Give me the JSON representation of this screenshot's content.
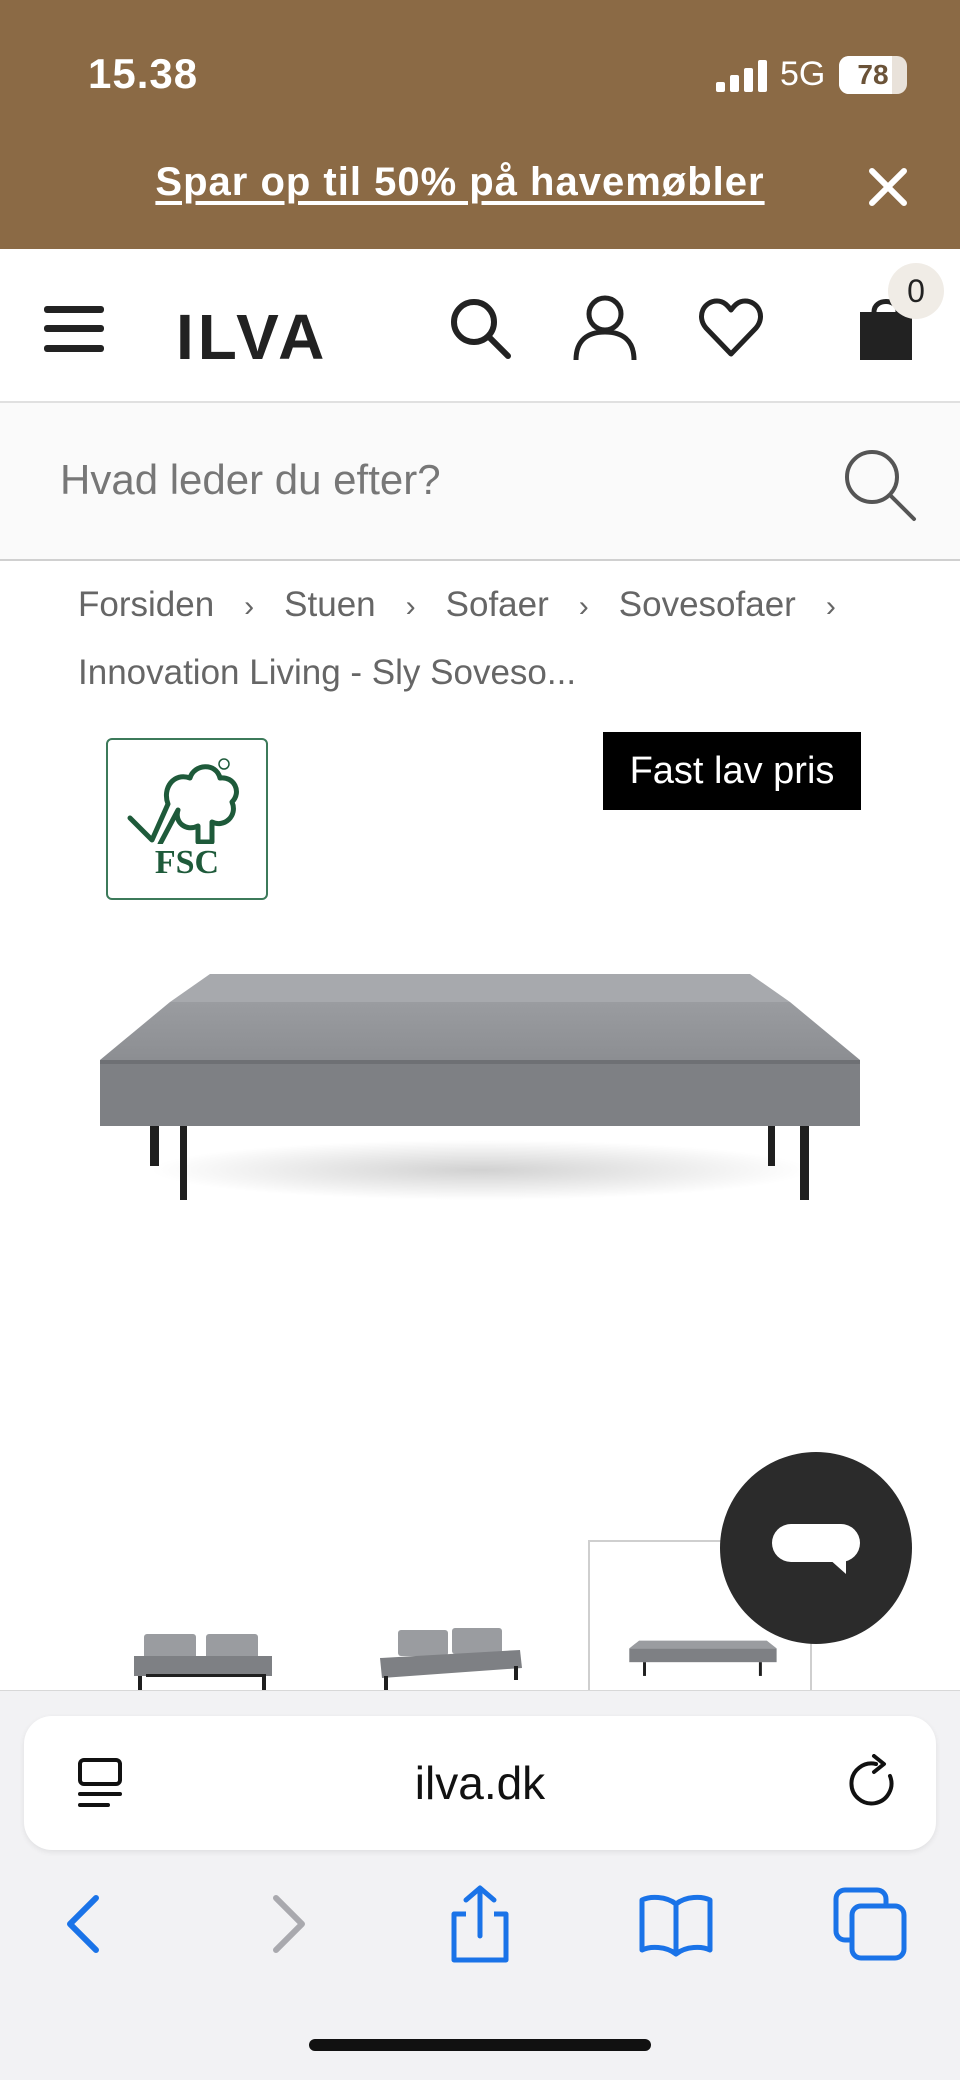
{
  "status_bar": {
    "time": "15.38",
    "network": "5G",
    "battery_percent": "78",
    "battery_level": 0.78,
    "icons": [
      "signal-icon",
      "battery-icon"
    ]
  },
  "promo": {
    "text": "Spar op til 50% på havemøbler",
    "close_icon": "close-icon"
  },
  "header": {
    "logo": "ILVA",
    "icons": [
      "menu-icon",
      "search-icon",
      "account-icon",
      "wishlist-icon",
      "cart-icon"
    ],
    "cart_count": "0"
  },
  "search": {
    "placeholder": "Hvad leder du efter?"
  },
  "breadcrumb": {
    "items": [
      "Forsiden",
      "Stuen",
      "Sofaer",
      "Sovesofaer",
      "Innovation Living - Sly Soveso..."
    ],
    "separator": "›"
  },
  "product": {
    "certification": "FSC",
    "price_badge": "Fast lav pris",
    "colors": {
      "fabric": "#8a8c90",
      "fabric_top": "#a3a5a9",
      "legs": "#1f1f1f",
      "fsc_green": "#1e5a3a"
    }
  },
  "chat": {
    "icon": "chat-icon"
  },
  "browser": {
    "url": "ilva.dk",
    "icons": [
      "page-menu-icon",
      "reload-icon",
      "back-icon",
      "forward-icon",
      "share-icon",
      "bookmarks-icon",
      "tabs-icon"
    ],
    "accent": "#1a73e8"
  },
  "colors": {
    "promo_bg": "#8b6a45",
    "text": "#222222"
  }
}
